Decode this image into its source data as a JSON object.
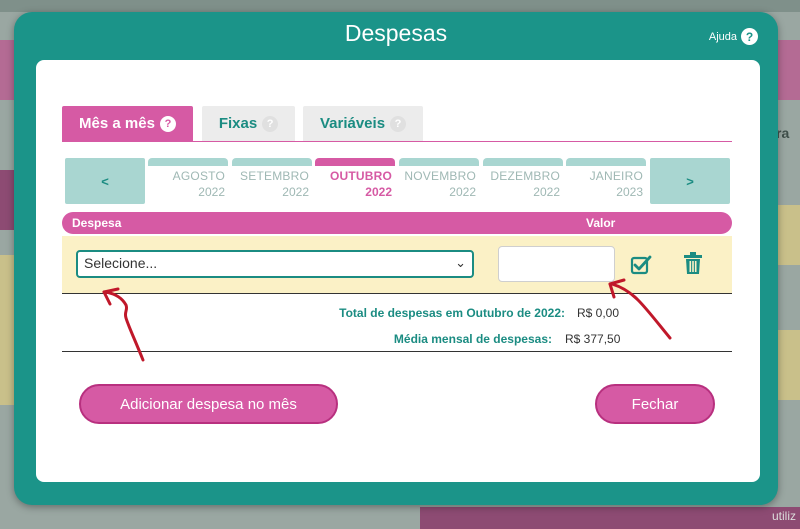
{
  "modal": {
    "title": "Despesas",
    "help_label": "Ajuda",
    "help_icon": "?"
  },
  "tabs": [
    {
      "label": "Mês a mês",
      "active": true
    },
    {
      "label": "Fixas",
      "active": false
    },
    {
      "label": "Variáveis",
      "active": false
    }
  ],
  "months": {
    "prev": "<",
    "next": ">",
    "items": [
      {
        "name": "AGOSTO",
        "year": "2022"
      },
      {
        "name": "SETEMBRO",
        "year": "2022"
      },
      {
        "name": "OUTUBRO",
        "year": "2022",
        "active": true
      },
      {
        "name": "NOVEMBRO",
        "year": "2022"
      },
      {
        "name": "DEZEMBRO",
        "year": "2022"
      },
      {
        "name": "JANEIRO",
        "year": "2023"
      }
    ]
  },
  "table": {
    "col_expense": "Despesa",
    "col_value": "Valor",
    "select_value": "Selecione...",
    "value_input": ""
  },
  "totals": {
    "total_label": "Total de despesas em Outubro de 2022:",
    "total_value": "R$ 0,00",
    "avg_label": "Média mensal de despesas:",
    "avg_value": "R$ 377,50"
  },
  "buttons": {
    "add": "Adicionar despesa no mês",
    "close": "Fechar"
  },
  "background": {
    "right_text": "ra",
    "bottom_text": "utiliz"
  },
  "colors": {
    "teal": "#1b9489",
    "pink": "#d65aa4",
    "light_teal": "#a9d6d1",
    "row_yellow": "#fbf1c6",
    "arrow_red": "#c0182a"
  }
}
